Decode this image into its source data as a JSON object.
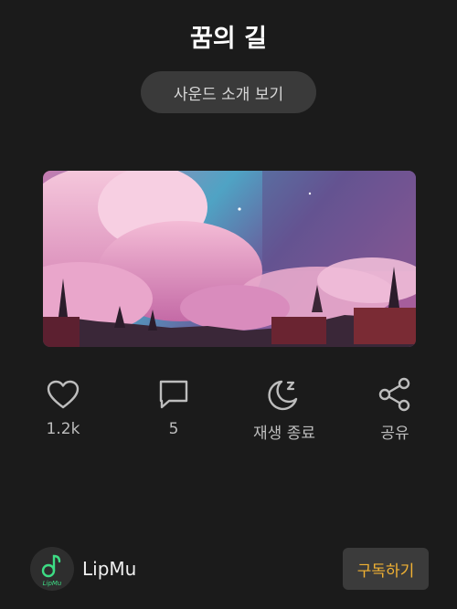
{
  "title": "꿈의 길",
  "intro_button": "사운드 소개 보기",
  "cover": {
    "description_icon": "cover-image"
  },
  "actions": [
    {
      "name": "like",
      "icon": "heart-icon",
      "label": "1.2k"
    },
    {
      "name": "comment",
      "icon": "comment-icon",
      "label": "5"
    },
    {
      "name": "sleep-timer",
      "icon": "moon-icon",
      "label": "재생 종료"
    },
    {
      "name": "share",
      "icon": "share-icon",
      "label": "공유"
    }
  ],
  "channel": {
    "name": "LipMu",
    "avatar_text": "LipMu"
  },
  "subscribe_button": "구독하기",
  "colors": {
    "background": "#1b1b1b",
    "accent": "#f2b233",
    "pill": "#3a3a3a"
  }
}
